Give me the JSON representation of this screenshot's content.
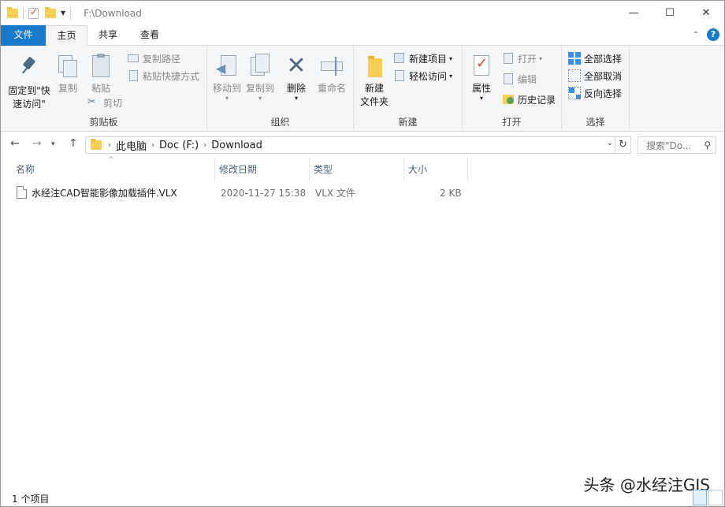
{
  "title_bar": {
    "path": "F:\\Download",
    "minimize": "—",
    "maximize": "☐",
    "close": "✕"
  },
  "tabs": [
    {
      "label": "文件"
    },
    {
      "label": "主页"
    },
    {
      "label": "共享"
    },
    {
      "label": "查看"
    }
  ],
  "ribbon": {
    "clipboard": {
      "pin_line1": "固定到\"快",
      "pin_line2": "速访问\"",
      "copy": "复制",
      "paste": "粘贴",
      "copy_path": "复制路径",
      "paste_shortcut": "粘贴快捷方式",
      "cut": "剪切",
      "group": "剪贴板"
    },
    "organize": {
      "move_to": "移动到",
      "copy_to": "复制到",
      "delete": "删除",
      "rename": "重命名",
      "group": "组织"
    },
    "new": {
      "new_folder_line1": "新建",
      "new_folder_line2": "文件夹",
      "new_item": "新建项目",
      "easy_access": "轻松访问",
      "group": "新建"
    },
    "open": {
      "properties": "属性",
      "open": "打开",
      "edit": "编辑",
      "history": "历史记录",
      "group": "打开"
    },
    "select": {
      "select_all": "全部选择",
      "select_none": "全部取消",
      "invert": "反向选择",
      "group": "选择"
    }
  },
  "address": {
    "crumbs": [
      "此电脑",
      "Doc (F:)",
      "Download"
    ],
    "search_placeholder": "搜索\"Do..."
  },
  "columns": [
    "名称",
    "修改日期",
    "类型",
    "大小"
  ],
  "files": [
    {
      "name": "水经注CAD智能影像加载插件.VLX",
      "modified": "2020-11-27 15:38",
      "type": "VLX 文件",
      "size": "2 KB"
    }
  ],
  "status": {
    "count": "1 个项目"
  },
  "watermark": "头条 @水经注GIS",
  "colors": {
    "accent": "#1979ca",
    "ribbon_bg": "#f5f6f7",
    "folder": "#f7cf55"
  }
}
